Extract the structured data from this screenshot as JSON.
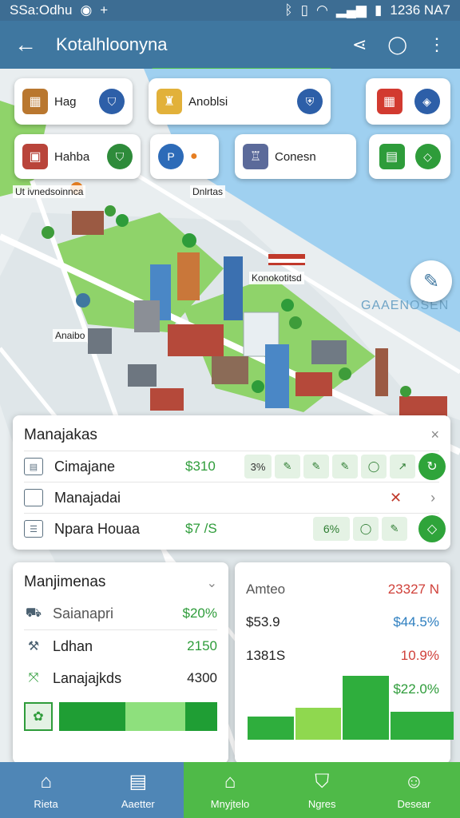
{
  "status_bar": {
    "left_text": "SSa:Odhu",
    "right_text": "1236 NA7"
  },
  "app_bar": {
    "title": "Kotalhloonyna"
  },
  "map": {
    "poi_cards": [
      {
        "label": "Hag"
      },
      {
        "label": "Anoblsi"
      },
      {
        "label": "Hahba"
      },
      {
        "label": "Conesn"
      }
    ],
    "labels": [
      "Ut ivnedsoinnca",
      "Dnlrtas",
      "Konokotitsd",
      "Anaibo"
    ],
    "watermark": "GAAENOSEN",
    "colors": {
      "water": "#9fd0f0",
      "land": "#e9eef0",
      "park": "#8fd36a",
      "road": "#ffffff"
    }
  },
  "quick_panel": {
    "title": "Manajakas",
    "rows": [
      {
        "label": "Cimajane",
        "value": "$310",
        "chip_text": "3%"
      },
      {
        "label": "Manajadai"
      },
      {
        "label": "Npara Houaa",
        "value": "$7 /S",
        "chip_text": "6%"
      }
    ]
  },
  "left_panel": {
    "title": "Manjimenas",
    "rows": [
      {
        "label": "Saianapri",
        "value": "$20%"
      },
      {
        "label": "Ldhan",
        "value": "2150"
      },
      {
        "label": "Lanajajkds",
        "value": "4300"
      }
    ],
    "progress": {
      "segment_start": 0.42,
      "segment_end": 0.8
    }
  },
  "right_panel": {
    "header_label": "Amteo",
    "header_value": "23327 N",
    "rows": [
      {
        "label": "$53.9",
        "value": "$44.5%"
      },
      {
        "label": "1381S",
        "value": "10.9%"
      },
      {
        "label": "",
        "value": "$22.0%"
      }
    ],
    "chart_data": {
      "type": "bar",
      "values": [
        35,
        48,
        95,
        42
      ]
    }
  },
  "bottom_nav": {
    "items": [
      {
        "label": "Rieta"
      },
      {
        "label": "Aaetter"
      },
      {
        "label": "Mnyjtelo"
      },
      {
        "label": "Ngres"
      },
      {
        "label": "Desear"
      }
    ],
    "colors": {
      "blue": "#4f86b6",
      "green": "#4fba48"
    }
  }
}
